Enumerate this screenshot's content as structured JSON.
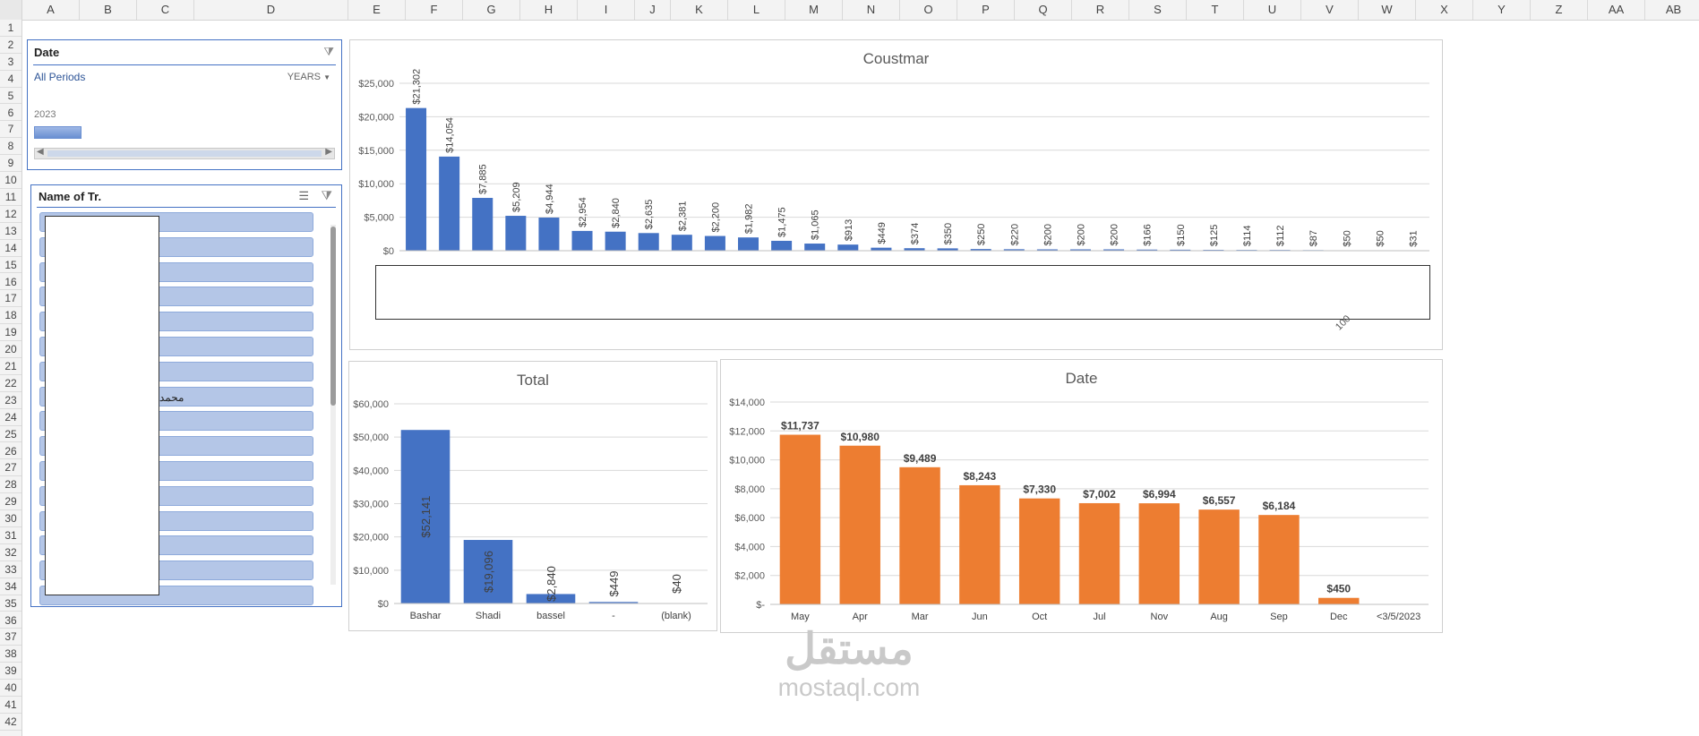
{
  "columns": [
    "A",
    "B",
    "C",
    "D",
    "E",
    "F",
    "G",
    "H",
    "I",
    "J",
    "K",
    "L",
    "M",
    "N",
    "O",
    "P",
    "Q",
    "R",
    "S",
    "T",
    "U",
    "V",
    "W",
    "X",
    "Y",
    "Z",
    "AA",
    "AB"
  ],
  "rows": [
    "1",
    "2",
    "3",
    "4",
    "5",
    "6",
    "7",
    "8",
    "9",
    "10",
    "11",
    "12",
    "13",
    "14",
    "15",
    "16",
    "17",
    "18",
    "19",
    "20",
    "21",
    "22",
    "23",
    "24",
    "25",
    "26",
    "27",
    "28",
    "29",
    "30",
    "31",
    "32",
    "33",
    "34",
    "35",
    "36",
    "37",
    "38",
    "39",
    "40",
    "41",
    "42"
  ],
  "date_slicer": {
    "title": "Date",
    "period_label": "All Periods",
    "level_label": "YEARS",
    "year_label": "2023"
  },
  "name_slicer": {
    "title": "Name of Tr.",
    "visible_item_text": "محمد"
  },
  "charts": {
    "customer": {
      "title": "Coustmar",
      "partial_label": "100"
    },
    "total": {
      "title": "Total"
    },
    "date": {
      "title": "Date"
    }
  },
  "chart_data": [
    {
      "type": "bar",
      "title": "Coustmar",
      "ylim": [
        0,
        25000
      ],
      "yticks": [
        "$0",
        "$5,000",
        "$10,000",
        "$15,000",
        "$20,000",
        "$25,000"
      ],
      "values": [
        21302,
        14054,
        7885,
        5209,
        4944,
        2954,
        2840,
        2635,
        2381,
        2200,
        1982,
        1475,
        1065,
        913,
        449,
        374,
        350,
        250,
        220,
        200,
        200,
        200,
        166,
        150,
        125,
        114,
        112,
        87,
        50,
        50,
        31
      ],
      "labels": [
        "$21,302",
        "$14,054",
        "$7,885",
        "$5,209",
        "$4,944",
        "$2,954",
        "$2,840",
        "$2,635",
        "$2,381",
        "$2,200",
        "$1,982",
        "$1,475",
        "$1,065",
        "$913",
        "$449",
        "$374",
        "$350",
        "$250",
        "$220",
        "$200",
        "$200",
        "$200",
        "$166",
        "$150",
        "$125",
        "$114",
        "$112",
        "$87",
        "$50",
        "$50",
        "$31"
      ],
      "color": "#4472c4"
    },
    {
      "type": "bar",
      "title": "Total",
      "categories": [
        "Bashar",
        "Shadi",
        "bassel",
        "-",
        "(blank)"
      ],
      "values": [
        52141,
        19096,
        2840,
        449,
        40
      ],
      "labels": [
        "$52,141",
        "$19,096",
        "$2,840",
        "$449",
        "$40"
      ],
      "ylim": [
        0,
        60000
      ],
      "yticks": [
        "$0",
        "$10,000",
        "$20,000",
        "$30,000",
        "$40,000",
        "$50,000",
        "$60,000"
      ],
      "color": "#4472c4"
    },
    {
      "type": "bar",
      "title": "Date",
      "categories": [
        "May",
        "Apr",
        "Mar",
        "Jun",
        "Oct",
        "Jul",
        "Nov",
        "Aug",
        "Sep",
        "Dec",
        "<3/5/2023"
      ],
      "values": [
        11737,
        10980,
        9489,
        8243,
        7330,
        7002,
        6994,
        6557,
        6184,
        450,
        0
      ],
      "labels": [
        "$11,737",
        "$10,980",
        "$9,489",
        "$8,243",
        "$7,330",
        "$7,002",
        "$6,994",
        "$6,557",
        "$6,184",
        "$450",
        ""
      ],
      "ylim": [
        0,
        14000
      ],
      "yticks": [
        "$-",
        "$2,000",
        "$4,000",
        "$6,000",
        "$8,000",
        "$10,000",
        "$12,000",
        "$14,000"
      ],
      "color": "#ed7d31"
    }
  ],
  "watermark": {
    "arabic": "مستقل",
    "latin": "mostaql.com"
  }
}
